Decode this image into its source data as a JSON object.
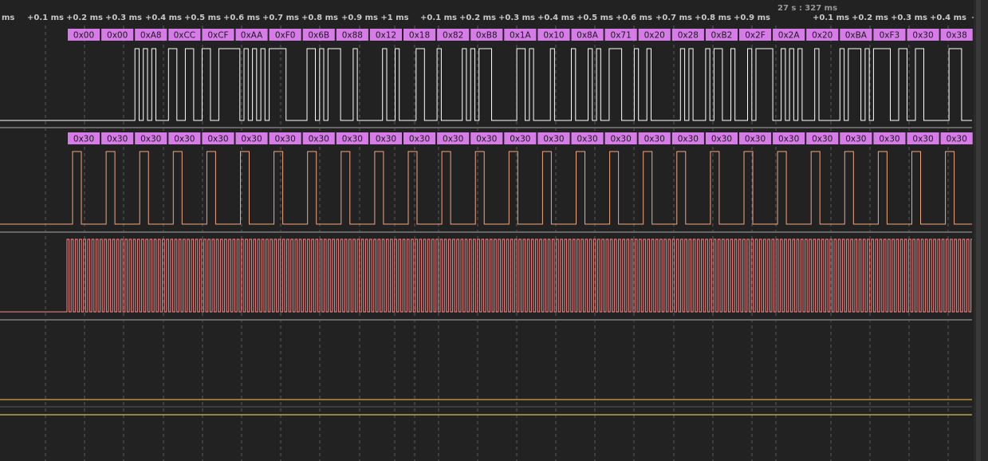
{
  "ruler": {
    "corner_label": "ms",
    "absolute_label": "27 s : 327 ms",
    "ticks": [
      "+0.1 ms",
      "+0.2 ms",
      "+0.3 ms",
      "+0.4 ms",
      "+0.5 ms",
      "+0.6 ms",
      "+0.7 ms",
      "+0.8 ms",
      "+0.9 ms",
      "+1 ms",
      "+0.1 ms",
      "+0.2 ms",
      "+0.3 ms",
      "+0.4 ms",
      "+0.5 ms",
      "+0.6 ms",
      "+0.7 ms",
      "+0.8 ms",
      "+0.9 ms",
      "+0.1 ms",
      "+0.2 ms",
      "+0.3 ms",
      "+0.4 ms",
      "+"
    ]
  },
  "channels": [
    {
      "id": "data",
      "color": "#ffffff",
      "frames": [
        "0x00",
        "0x00",
        "0xA8",
        "0xCC",
        "0xCF",
        "0xAA",
        "0xF0",
        "0x6B",
        "0x88",
        "0x12",
        "0x18",
        "0x82",
        "0xB8",
        "0x1A",
        "0x10",
        "0x8A",
        "0x71",
        "0x20",
        "0x28",
        "0xB2",
        "0x2F",
        "0x2A",
        "0x20",
        "0xBA",
        "0xF3",
        "0x30",
        "0x38"
      ]
    },
    {
      "id": "select",
      "color": "#f4a582",
      "frames": [
        "0x30",
        "0x30",
        "0x30",
        "0x30",
        "0x30",
        "0x30",
        "0x30",
        "0x30",
        "0x30",
        "0x30",
        "0x30",
        "0x30",
        "0x30",
        "0x30",
        "0x30",
        "0x30",
        "0x30",
        "0x30",
        "0x30",
        "0x30",
        "0x30",
        "0x30",
        "0x30",
        "0x30",
        "0x30",
        "0x30",
        "0x30"
      ]
    },
    {
      "id": "clock",
      "color": "#ff8a8a"
    },
    {
      "id": "line-4",
      "color": "#ffc94a"
    },
    {
      "id": "line-5",
      "color": "#ffe066"
    }
  ],
  "colors": {
    "background": "#222222",
    "frame_box": "#d67be8",
    "grid": "#5a5a5a",
    "separator": "#666666"
  }
}
